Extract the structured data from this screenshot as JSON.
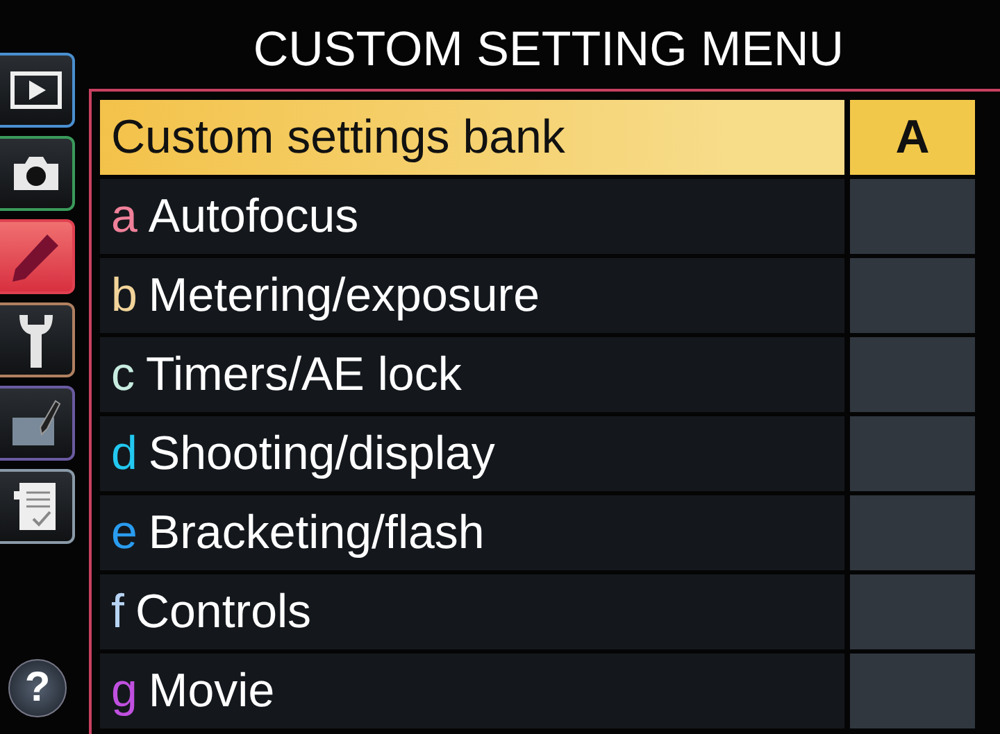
{
  "title": "CUSTOM SETTING MENU",
  "tabs": [
    {
      "kind": "playback",
      "selected": false
    },
    {
      "kind": "shooting",
      "selected": false
    },
    {
      "kind": "custom",
      "selected": true
    },
    {
      "kind": "setup",
      "selected": false
    },
    {
      "kind": "retouch",
      "selected": false
    },
    {
      "kind": "mymenu",
      "selected": false
    }
  ],
  "help": {
    "label": "?"
  },
  "rows": [
    {
      "kind": "bank",
      "label": "Custom settings bank",
      "value": "A",
      "selected": true
    },
    {
      "kind": "group",
      "letter": "a",
      "color": "#f0809a",
      "label": "Autofocus",
      "selected": false
    },
    {
      "kind": "group",
      "letter": "b",
      "color": "#f2d49a",
      "label": "Metering/exposure",
      "selected": false
    },
    {
      "kind": "group",
      "letter": "c",
      "color": "#c8ece0",
      "label": "Timers/AE lock",
      "selected": false
    },
    {
      "kind": "group",
      "letter": "d",
      "color": "#22c8f0",
      "label": "Shooting/display",
      "selected": false
    },
    {
      "kind": "group",
      "letter": "e",
      "color": "#2a9cf0",
      "label": "Bracketing/flash",
      "selected": false
    },
    {
      "kind": "group",
      "letter": "f",
      "color": "#b8d4f4",
      "label": "Controls",
      "selected": false
    },
    {
      "kind": "group",
      "letter": "g",
      "color": "#c050e0",
      "label": "Movie",
      "selected": false
    }
  ]
}
